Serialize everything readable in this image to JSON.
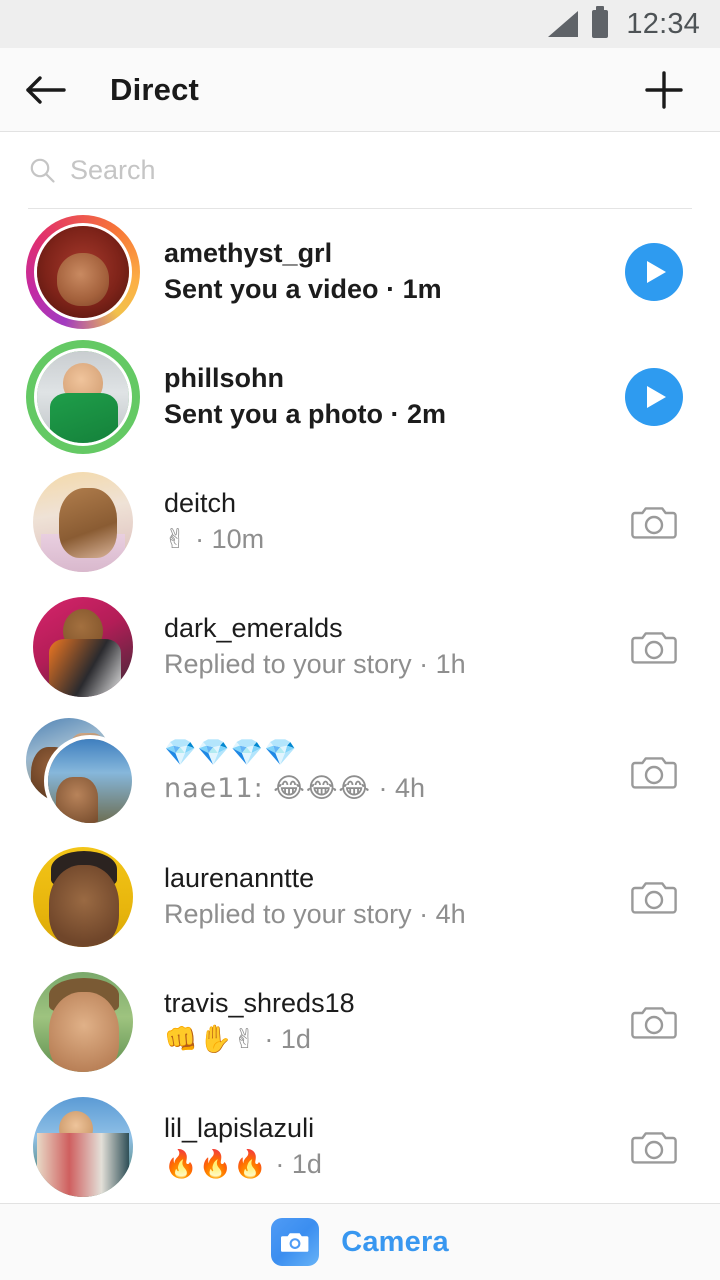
{
  "status_bar": {
    "time": "12:34",
    "signal_icon": "signal-icon",
    "battery_icon": "battery-icon"
  },
  "header": {
    "title": "Direct",
    "back_icon": "back-arrow-icon",
    "new_message_icon": "plus-icon"
  },
  "search": {
    "placeholder": "Search",
    "value": "",
    "icon": "search-icon"
  },
  "colors": {
    "accent_blue": "#3897f0",
    "play_blue": "#2e9bf0",
    "unread_green": "#64c964",
    "muted_text": "#8e8e8e",
    "primary_text": "#1c1c1c",
    "status_bar_bg": "#eeeeee",
    "header_bg": "#fafafa"
  },
  "threads": [
    {
      "name": "amethyst_grl",
      "preview": "Sent you a video",
      "separator": "·",
      "time": "1m",
      "unread": true,
      "ring": "gradient",
      "action_icon": "play-icon",
      "avatar_style": "ph-a",
      "avatar_type": "single"
    },
    {
      "name": "phillsohn",
      "preview": "Sent you a photo",
      "separator": "·",
      "time": "2m",
      "unread": true,
      "ring": "green",
      "action_icon": "play-icon",
      "avatar_style": "ph-b",
      "avatar_type": "single"
    },
    {
      "name": "deitch",
      "preview": "✌",
      "separator": "·",
      "time": "10m",
      "unread": false,
      "ring": "none",
      "action_icon": "camera-icon",
      "avatar_style": "ph-c",
      "avatar_type": "single"
    },
    {
      "name": "dark_emeralds",
      "preview": "Replied to your story",
      "separator": "·",
      "time": "1h",
      "unread": false,
      "ring": "none",
      "action_icon": "camera-icon",
      "avatar_style": "ph-d",
      "avatar_type": "single"
    },
    {
      "name": "💎💎💎💎",
      "preview": "nae11: 😂😂😂",
      "separator": "·",
      "time": "4h",
      "unread": false,
      "ring": "none",
      "action_icon": "camera-icon",
      "avatar_style": "ph-e",
      "avatar_style_back": "ph-f",
      "avatar_type": "group"
    },
    {
      "name": "laurenanntte",
      "preview": "Replied to your story",
      "separator": "·",
      "time": "4h",
      "unread": false,
      "ring": "none",
      "action_icon": "camera-icon",
      "avatar_style": "ph-g",
      "avatar_type": "single"
    },
    {
      "name": "travis_shreds18",
      "preview": "👊✋✌",
      "separator": "·",
      "time": "1d",
      "unread": false,
      "ring": "none",
      "action_icon": "camera-icon",
      "avatar_style": "ph-h",
      "avatar_type": "single"
    },
    {
      "name": "lil_lapislazuli",
      "preview": "🔥🔥🔥",
      "separator": "·",
      "time": "1d",
      "unread": false,
      "ring": "none",
      "action_icon": "camera-icon",
      "avatar_style": "ph-j",
      "avatar_type": "single"
    }
  ],
  "bottom_bar": {
    "camera_label": "Camera",
    "camera_icon": "camera-icon"
  }
}
